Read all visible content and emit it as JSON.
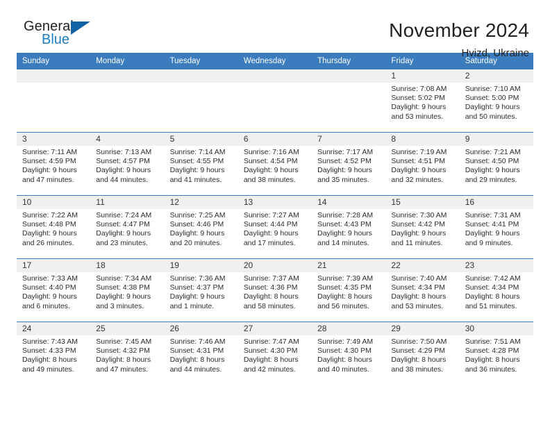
{
  "brand": {
    "name_top": "General",
    "name_bottom": "Blue",
    "triangle_color": "#1263a6",
    "blue_color": "#1c7fc4"
  },
  "header": {
    "title": "November 2024",
    "subtitle": "Hvizd, Ukraine"
  },
  "theme": {
    "header_blue": "#3a7cbe",
    "daynum_band": "#f0f0f0"
  },
  "weekdays": [
    "Sunday",
    "Monday",
    "Tuesday",
    "Wednesday",
    "Thursday",
    "Friday",
    "Saturday"
  ],
  "labels": {
    "sunrise_prefix": "Sunrise: ",
    "sunset_prefix": "Sunset: ",
    "daylight_prefix": "Daylight: "
  },
  "weeks": [
    [
      {
        "empty": true
      },
      {
        "empty": true
      },
      {
        "empty": true
      },
      {
        "empty": true
      },
      {
        "empty": true
      },
      {
        "day": "1",
        "sunrise": "Sunrise: 7:08 AM",
        "sunset": "Sunset: 5:02 PM",
        "daylight1": "Daylight: 9 hours",
        "daylight2": "and 53 minutes."
      },
      {
        "day": "2",
        "sunrise": "Sunrise: 7:10 AM",
        "sunset": "Sunset: 5:00 PM",
        "daylight1": "Daylight: 9 hours",
        "daylight2": "and 50 minutes."
      }
    ],
    [
      {
        "day": "3",
        "sunrise": "Sunrise: 7:11 AM",
        "sunset": "Sunset: 4:59 PM",
        "daylight1": "Daylight: 9 hours",
        "daylight2": "and 47 minutes."
      },
      {
        "day": "4",
        "sunrise": "Sunrise: 7:13 AM",
        "sunset": "Sunset: 4:57 PM",
        "daylight1": "Daylight: 9 hours",
        "daylight2": "and 44 minutes."
      },
      {
        "day": "5",
        "sunrise": "Sunrise: 7:14 AM",
        "sunset": "Sunset: 4:55 PM",
        "daylight1": "Daylight: 9 hours",
        "daylight2": "and 41 minutes."
      },
      {
        "day": "6",
        "sunrise": "Sunrise: 7:16 AM",
        "sunset": "Sunset: 4:54 PM",
        "daylight1": "Daylight: 9 hours",
        "daylight2": "and 38 minutes."
      },
      {
        "day": "7",
        "sunrise": "Sunrise: 7:17 AM",
        "sunset": "Sunset: 4:52 PM",
        "daylight1": "Daylight: 9 hours",
        "daylight2": "and 35 minutes."
      },
      {
        "day": "8",
        "sunrise": "Sunrise: 7:19 AM",
        "sunset": "Sunset: 4:51 PM",
        "daylight1": "Daylight: 9 hours",
        "daylight2": "and 32 minutes."
      },
      {
        "day": "9",
        "sunrise": "Sunrise: 7:21 AM",
        "sunset": "Sunset: 4:50 PM",
        "daylight1": "Daylight: 9 hours",
        "daylight2": "and 29 minutes."
      }
    ],
    [
      {
        "day": "10",
        "sunrise": "Sunrise: 7:22 AM",
        "sunset": "Sunset: 4:48 PM",
        "daylight1": "Daylight: 9 hours",
        "daylight2": "and 26 minutes."
      },
      {
        "day": "11",
        "sunrise": "Sunrise: 7:24 AM",
        "sunset": "Sunset: 4:47 PM",
        "daylight1": "Daylight: 9 hours",
        "daylight2": "and 23 minutes."
      },
      {
        "day": "12",
        "sunrise": "Sunrise: 7:25 AM",
        "sunset": "Sunset: 4:46 PM",
        "daylight1": "Daylight: 9 hours",
        "daylight2": "and 20 minutes."
      },
      {
        "day": "13",
        "sunrise": "Sunrise: 7:27 AM",
        "sunset": "Sunset: 4:44 PM",
        "daylight1": "Daylight: 9 hours",
        "daylight2": "and 17 minutes."
      },
      {
        "day": "14",
        "sunrise": "Sunrise: 7:28 AM",
        "sunset": "Sunset: 4:43 PM",
        "daylight1": "Daylight: 9 hours",
        "daylight2": "and 14 minutes."
      },
      {
        "day": "15",
        "sunrise": "Sunrise: 7:30 AM",
        "sunset": "Sunset: 4:42 PM",
        "daylight1": "Daylight: 9 hours",
        "daylight2": "and 11 minutes."
      },
      {
        "day": "16",
        "sunrise": "Sunrise: 7:31 AM",
        "sunset": "Sunset: 4:41 PM",
        "daylight1": "Daylight: 9 hours",
        "daylight2": "and 9 minutes."
      }
    ],
    [
      {
        "day": "17",
        "sunrise": "Sunrise: 7:33 AM",
        "sunset": "Sunset: 4:40 PM",
        "daylight1": "Daylight: 9 hours",
        "daylight2": "and 6 minutes."
      },
      {
        "day": "18",
        "sunrise": "Sunrise: 7:34 AM",
        "sunset": "Sunset: 4:38 PM",
        "daylight1": "Daylight: 9 hours",
        "daylight2": "and 3 minutes."
      },
      {
        "day": "19",
        "sunrise": "Sunrise: 7:36 AM",
        "sunset": "Sunset: 4:37 PM",
        "daylight1": "Daylight: 9 hours",
        "daylight2": "and 1 minute."
      },
      {
        "day": "20",
        "sunrise": "Sunrise: 7:37 AM",
        "sunset": "Sunset: 4:36 PM",
        "daylight1": "Daylight: 8 hours",
        "daylight2": "and 58 minutes."
      },
      {
        "day": "21",
        "sunrise": "Sunrise: 7:39 AM",
        "sunset": "Sunset: 4:35 PM",
        "daylight1": "Daylight: 8 hours",
        "daylight2": "and 56 minutes."
      },
      {
        "day": "22",
        "sunrise": "Sunrise: 7:40 AM",
        "sunset": "Sunset: 4:34 PM",
        "daylight1": "Daylight: 8 hours",
        "daylight2": "and 53 minutes."
      },
      {
        "day": "23",
        "sunrise": "Sunrise: 7:42 AM",
        "sunset": "Sunset: 4:34 PM",
        "daylight1": "Daylight: 8 hours",
        "daylight2": "and 51 minutes."
      }
    ],
    [
      {
        "day": "24",
        "sunrise": "Sunrise: 7:43 AM",
        "sunset": "Sunset: 4:33 PM",
        "daylight1": "Daylight: 8 hours",
        "daylight2": "and 49 minutes."
      },
      {
        "day": "25",
        "sunrise": "Sunrise: 7:45 AM",
        "sunset": "Sunset: 4:32 PM",
        "daylight1": "Daylight: 8 hours",
        "daylight2": "and 47 minutes."
      },
      {
        "day": "26",
        "sunrise": "Sunrise: 7:46 AM",
        "sunset": "Sunset: 4:31 PM",
        "daylight1": "Daylight: 8 hours",
        "daylight2": "and 44 minutes."
      },
      {
        "day": "27",
        "sunrise": "Sunrise: 7:47 AM",
        "sunset": "Sunset: 4:30 PM",
        "daylight1": "Daylight: 8 hours",
        "daylight2": "and 42 minutes."
      },
      {
        "day": "28",
        "sunrise": "Sunrise: 7:49 AM",
        "sunset": "Sunset: 4:30 PM",
        "daylight1": "Daylight: 8 hours",
        "daylight2": "and 40 minutes."
      },
      {
        "day": "29",
        "sunrise": "Sunrise: 7:50 AM",
        "sunset": "Sunset: 4:29 PM",
        "daylight1": "Daylight: 8 hours",
        "daylight2": "and 38 minutes."
      },
      {
        "day": "30",
        "sunrise": "Sunrise: 7:51 AM",
        "sunset": "Sunset: 4:28 PM",
        "daylight1": "Daylight: 8 hours",
        "daylight2": "and 36 minutes."
      }
    ]
  ]
}
